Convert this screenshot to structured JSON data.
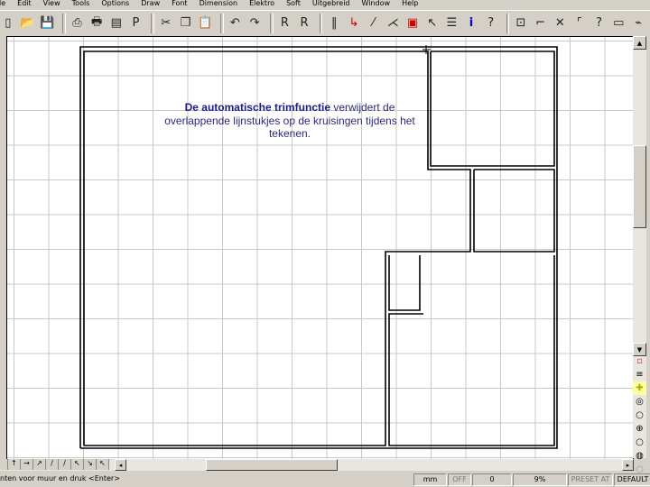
{
  "menu": [
    "le",
    "Edit",
    "View",
    "Tools",
    "Options",
    "Draw",
    "Font",
    "Dimension",
    "Elektro",
    "Soft",
    "Uitgebreid",
    "Window",
    "Help"
  ],
  "toolbar_icons": [
    "new",
    "open-folder",
    "save",
    "print",
    "print-preview",
    "preview-page",
    "properties",
    "cut",
    "copy",
    "paste",
    "undo",
    "redo",
    "new-r",
    "open-r",
    "wall-double",
    "line-angle",
    "line-node",
    "trim",
    "select-box",
    "pick",
    "layers",
    "info",
    "help-pointer",
    "zoom-window",
    "snap",
    "close-x",
    "corner",
    "question",
    "display",
    "toggle"
  ],
  "message": {
    "bold": "De automatische trimfunctie",
    "rest": " verwijdert de overlappende lijnstukjes op de kruisingen tijdens het tekenen."
  },
  "status": {
    "prompt": "nten voor muur en druk <Enter>",
    "unit": "mm",
    "snap": "OFF",
    "value": "0",
    "zoom": "9%",
    "preset": "PRESET AT",
    "layer": "DEFAULT"
  },
  "hscroll_tools": [
    "↑",
    "→",
    "↗",
    "/",
    "/",
    "↖",
    "↘",
    "↖"
  ]
}
